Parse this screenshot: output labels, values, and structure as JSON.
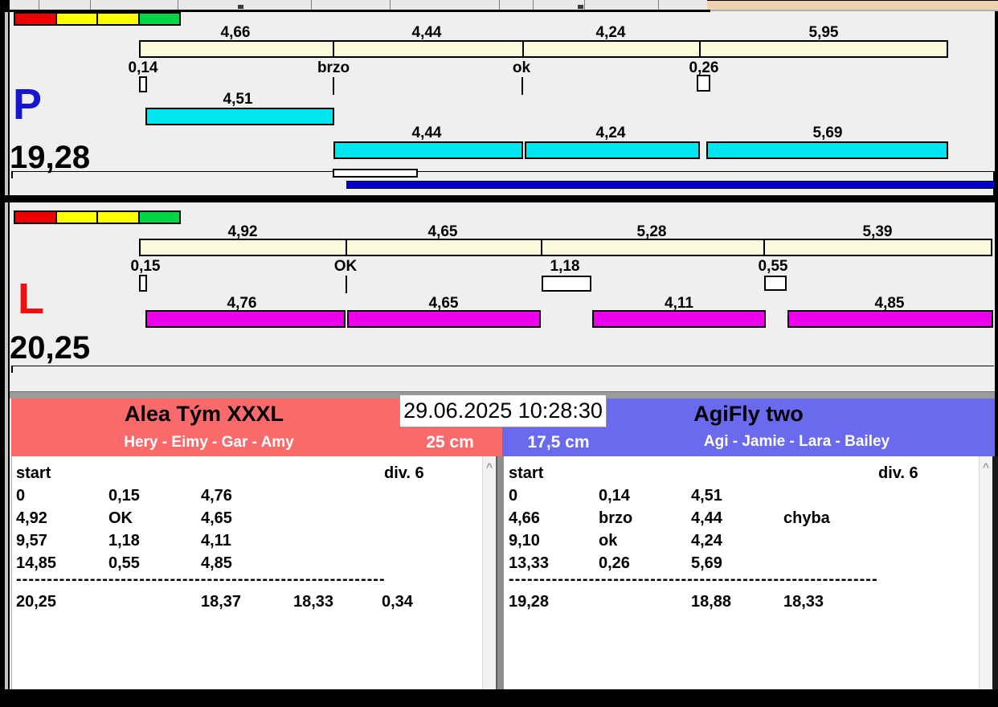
{
  "colors": {
    "panel_background": "#EFEFEF",
    "split_bar": "#FBFBDC",
    "run_bar_p": "#00E5EE",
    "run_bar_l": "#EC00EC",
    "progress_bar": "#0000C8",
    "letter_p": "#1616CE",
    "letter_l": "#EE1111",
    "team_left": "#F96A6A",
    "team_right": "#6A6AEE",
    "status_strip": [
      "#EE0000",
      "#FFFF00",
      "#FFFF00",
      "#00D545"
    ]
  },
  "panels": {
    "p": {
      "letter": "P",
      "total": "19,28",
      "segment_labels": [
        "4,66",
        "4,44",
        "4,24",
        "5,95"
      ],
      "tick_labels": [
        "0,14",
        "brzo",
        "ok",
        "0,26"
      ],
      "run_labels": [
        "4,51",
        "4,44",
        "4,24",
        "5,69"
      ]
    },
    "l": {
      "letter": "L",
      "total": "20,25",
      "segment_labels": [
        "4,92",
        "4,65",
        "5,28",
        "5,39"
      ],
      "tick_labels": [
        "0,15",
        "OK",
        "1,18",
        "0,55"
      ],
      "run_labels": [
        "4,76",
        "4,65",
        "4,11",
        "4,85"
      ]
    }
  },
  "footer": {
    "timestamp": "29.06.2025 10:28:30",
    "teams": {
      "left": {
        "name": "Alea Tým XXXL",
        "members": "Hery - Eimy - Gar - Amy",
        "jump_height": "25 cm",
        "table": {
          "header_left": "start",
          "header_right": "div. 6",
          "rows": [
            [
              "0",
              "0,15",
              "4,76",
              ""
            ],
            [
              "4,92",
              "OK",
              "4,65",
              ""
            ],
            [
              "9,57",
              "1,18",
              "4,11",
              ""
            ],
            [
              "14,85",
              "0,55",
              "4,85",
              ""
            ]
          ],
          "dashes": "------------------------------------------------------------",
          "totals": [
            "20,25",
            "18,37",
            "18,33",
            "0,34"
          ]
        }
      },
      "right": {
        "name": "AgiFly two",
        "members": "Agi - Jamie - Lara - Bailey",
        "jump_height": "17,5 cm",
        "table": {
          "header_left": "start",
          "header_right": "div. 6",
          "rows": [
            [
              "0",
              "0,14",
              "4,51",
              ""
            ],
            [
              "4,66",
              "brzo",
              "4,44",
              "chyba"
            ],
            [
              "9,10",
              "ok",
              "4,24",
              ""
            ],
            [
              "13,33",
              "0,26",
              "5,69",
              ""
            ]
          ],
          "dashes": "------------------------------------------------------------",
          "totals": [
            "19,28",
            "18,88",
            "18,33",
            ""
          ]
        }
      }
    }
  },
  "scrollbar": {
    "up_glyph": "^"
  }
}
